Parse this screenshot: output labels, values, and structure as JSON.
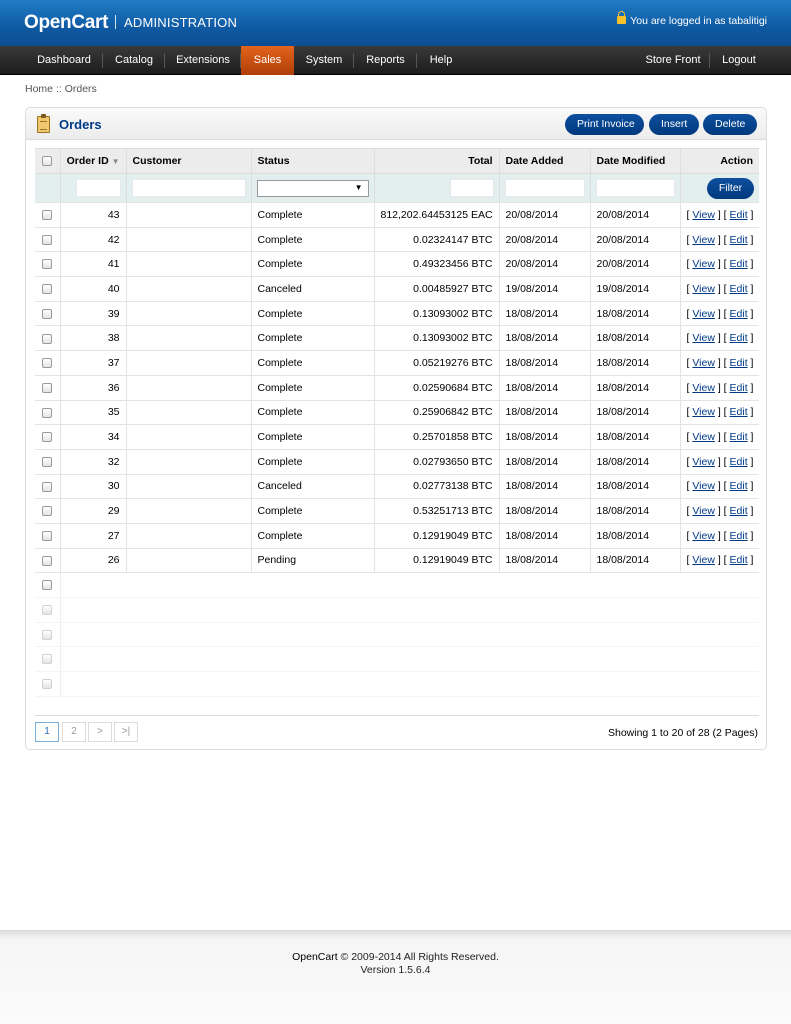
{
  "header": {
    "logo": "OpenCart",
    "subtitle": "ADMINISTRATION",
    "login_text": "You are logged in as tabalitigi"
  },
  "menu": {
    "left": [
      "Dashboard",
      "Catalog",
      "Extensions",
      "Sales",
      "System",
      "Reports",
      "Help"
    ],
    "right": [
      "Store Front",
      "Logout"
    ],
    "active": "Sales"
  },
  "breadcrumb": {
    "home": "Home",
    "separator": "::",
    "current": "Orders"
  },
  "box": {
    "title": "Orders",
    "buttons": {
      "print_invoice": "Print Invoice",
      "insert": "Insert",
      "delete": "Delete"
    }
  },
  "table": {
    "headers": {
      "order_id": "Order ID",
      "customer": "Customer",
      "status": "Status",
      "total": "Total",
      "date_added": "Date Added",
      "date_modified": "Date Modified",
      "action": "Action"
    },
    "filter_button": "Filter",
    "view_label": "View",
    "edit_label": "Edit",
    "rows": [
      {
        "id": "43",
        "customer": "",
        "status": "Complete",
        "total": "812,202.64453125 EAC",
        "date_added": "20/08/2014",
        "date_modified": "20/08/2014"
      },
      {
        "id": "42",
        "customer": "",
        "status": "Complete",
        "total": "0.02324147 BTC",
        "date_added": "20/08/2014",
        "date_modified": "20/08/2014"
      },
      {
        "id": "41",
        "customer": "",
        "status": "Complete",
        "total": "0.49323456 BTC",
        "date_added": "20/08/2014",
        "date_modified": "20/08/2014"
      },
      {
        "id": "40",
        "customer": "",
        "status": "Canceled",
        "total": "0.00485927 BTC",
        "date_added": "19/08/2014",
        "date_modified": "19/08/2014"
      },
      {
        "id": "39",
        "customer": "",
        "status": "Complete",
        "total": "0.13093002 BTC",
        "date_added": "18/08/2014",
        "date_modified": "18/08/2014"
      },
      {
        "id": "38",
        "customer": "",
        "status": "Complete",
        "total": "0.13093002 BTC",
        "date_added": "18/08/2014",
        "date_modified": "18/08/2014"
      },
      {
        "id": "37",
        "customer": "",
        "status": "Complete",
        "total": "0.05219276 BTC",
        "date_added": "18/08/2014",
        "date_modified": "18/08/2014"
      },
      {
        "id": "36",
        "customer": "",
        "status": "Complete",
        "total": "0.02590684 BTC",
        "date_added": "18/08/2014",
        "date_modified": "18/08/2014"
      },
      {
        "id": "35",
        "customer": "",
        "status": "Complete",
        "total": "0.25906842 BTC",
        "date_added": "18/08/2014",
        "date_modified": "18/08/2014"
      },
      {
        "id": "34",
        "customer": "",
        "status": "Complete",
        "total": "0.25701858 BTC",
        "date_added": "18/08/2014",
        "date_modified": "18/08/2014"
      },
      {
        "id": "32",
        "customer": "",
        "status": "Complete",
        "total": "0.02793650 BTC",
        "date_added": "18/08/2014",
        "date_modified": "18/08/2014"
      },
      {
        "id": "30",
        "customer": "",
        "status": "Canceled",
        "total": "0.02773138 BTC",
        "date_added": "18/08/2014",
        "date_modified": "18/08/2014"
      },
      {
        "id": "29",
        "customer": "",
        "status": "Complete",
        "total": "0.53251713 BTC",
        "date_added": "18/08/2014",
        "date_modified": "18/08/2014"
      },
      {
        "id": "27",
        "customer": "",
        "status": "Complete",
        "total": "0.12919049 BTC",
        "date_added": "18/08/2014",
        "date_modified": "18/08/2014"
      },
      {
        "id": "26",
        "customer": "",
        "status": "Pending",
        "total": "0.12919049 BTC",
        "date_added": "18/08/2014",
        "date_modified": "18/08/2014"
      }
    ],
    "empty_rows": 5
  },
  "pagination": {
    "links": [
      "1",
      "2",
      ">",
      ">|"
    ],
    "active": "1",
    "results": "Showing 1 to 20 of 28 (2 Pages)"
  },
  "footer": {
    "brand": "OpenCart",
    "copyright": "© 2009-2014 All Rights Reserved.",
    "version": "Version 1.5.6.4"
  },
  "colors": {
    "header_blue": "#0f5aa3",
    "active_tab": "#d4571a",
    "title_blue": "#003a88",
    "button_blue": "#003a7e"
  }
}
